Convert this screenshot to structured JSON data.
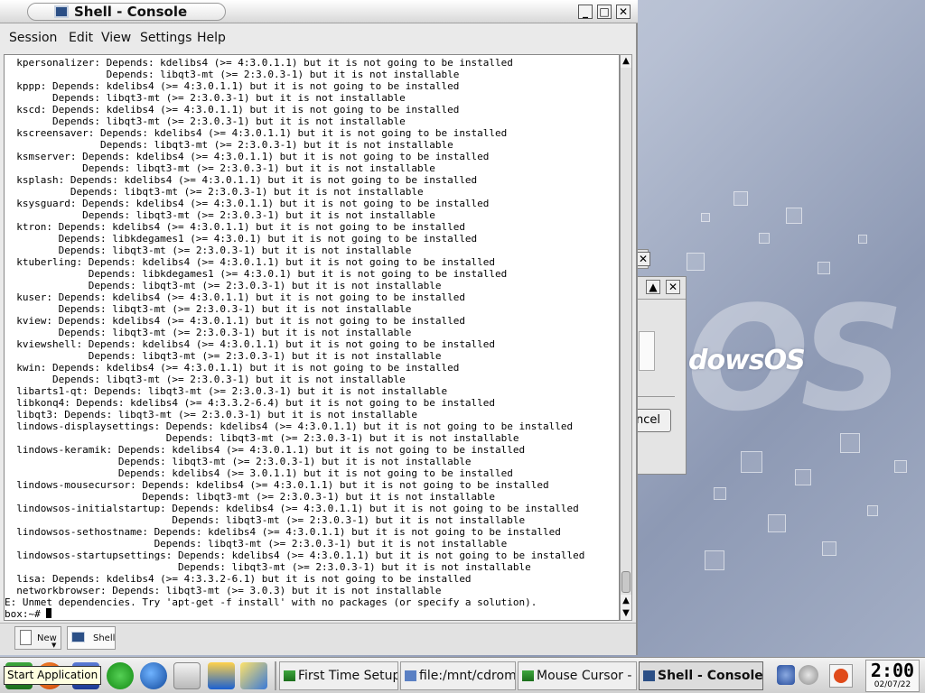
{
  "desktop": {
    "logo_text": "dowsOS",
    "logo_big": "OS",
    "bg_dialog_cancel": "ncel"
  },
  "window": {
    "title": "Shell - Console",
    "controls": {
      "minimize": "_",
      "maximize": "□",
      "close": "✕"
    }
  },
  "menubar": {
    "items": [
      "Session",
      "Edit",
      "View",
      "Settings",
      "Help"
    ]
  },
  "terminal": {
    "lines": [
      "  kpersonalizer: Depends: kdelibs4 (>= 4:3.0.1.1) but it is not going to be installed",
      "                 Depends: libqt3-mt (>= 2:3.0.3-1) but it is not installable",
      "  kppp: Depends: kdelibs4 (>= 4:3.0.1.1) but it is not going to be installed",
      "        Depends: libqt3-mt (>= 2:3.0.3-1) but it is not installable",
      "  kscd: Depends: kdelibs4 (>= 4:3.0.1.1) but it is not going to be installed",
      "        Depends: libqt3-mt (>= 2:3.0.3-1) but it is not installable",
      "  kscreensaver: Depends: kdelibs4 (>= 4:3.0.1.1) but it is not going to be installed",
      "                Depends: libqt3-mt (>= 2:3.0.3-1) but it is not installable",
      "  ksmserver: Depends: kdelibs4 (>= 4:3.0.1.1) but it is not going to be installed",
      "             Depends: libqt3-mt (>= 2:3.0.3-1) but it is not installable",
      "  ksplash: Depends: kdelibs4 (>= 4:3.0.1.1) but it is not going to be installed",
      "           Depends: libqt3-mt (>= 2:3.0.3-1) but it is not installable",
      "  ksysguard: Depends: kdelibs4 (>= 4:3.0.1.1) but it is not going to be installed",
      "             Depends: libqt3-mt (>= 2:3.0.3-1) but it is not installable",
      "  ktron: Depends: kdelibs4 (>= 4:3.0.1.1) but it is not going to be installed",
      "         Depends: libkdegames1 (>= 4:3.0.1) but it is not going to be installed",
      "         Depends: libqt3-mt (>= 2:3.0.3-1) but it is not installable",
      "  ktuberling: Depends: kdelibs4 (>= 4:3.0.1.1) but it is not going to be installed",
      "              Depends: libkdegames1 (>= 4:3.0.1) but it is not going to be installed",
      "              Depends: libqt3-mt (>= 2:3.0.3-1) but it is not installable",
      "  kuser: Depends: kdelibs4 (>= 4:3.0.1.1) but it is not going to be installed",
      "         Depends: libqt3-mt (>= 2:3.0.3-1) but it is not installable",
      "  kview: Depends: kdelibs4 (>= 4:3.0.1.1) but it is not going to be installed",
      "         Depends: libqt3-mt (>= 2:3.0.3-1) but it is not installable",
      "  kviewshell: Depends: kdelibs4 (>= 4:3.0.1.1) but it is not going to be installed",
      "              Depends: libqt3-mt (>= 2:3.0.3-1) but it is not installable",
      "  kwin: Depends: kdelibs4 (>= 4:3.0.1.1) but it is not going to be installed",
      "        Depends: libqt3-mt (>= 2:3.0.3-1) but it is not installable",
      "  libarts1-qt: Depends: libqt3-mt (>= 2:3.0.3-1) but it is not installable",
      "  libkonq4: Depends: kdelibs4 (>= 4:3.3.2-6.4) but it is not going to be installed",
      "  libqt3: Depends: libqt3-mt (>= 2:3.0.3-1) but it is not installable",
      "  lindows-displaysettings: Depends: kdelibs4 (>= 4:3.0.1.1) but it is not going to be installed",
      "                           Depends: libqt3-mt (>= 2:3.0.3-1) but it is not installable",
      "  lindows-keramik: Depends: kdelibs4 (>= 4:3.0.1.1) but it is not going to be installed",
      "                   Depends: libqt3-mt (>= 2:3.0.3-1) but it is not installable",
      "                   Depends: kdelibs4 (>= 3.0.1.1) but it is not going to be installed",
      "  lindows-mousecursor: Depends: kdelibs4 (>= 4:3.0.1.1) but it is not going to be installed",
      "                       Depends: libqt3-mt (>= 2:3.0.3-1) but it is not installable",
      "  lindowsos-initialstartup: Depends: kdelibs4 (>= 4:3.0.1.1) but it is not going to be installed",
      "                            Depends: libqt3-mt (>= 2:3.0.3-1) but it is not installable",
      "  lindowsos-sethostname: Depends: kdelibs4 (>= 4:3.0.1.1) but it is not going to be installed",
      "                         Depends: libqt3-mt (>= 2:3.0.3-1) but it is not installable",
      "  lindowsos-startupsettings: Depends: kdelibs4 (>= 4:3.0.1.1) but it is not going to be installed",
      "                             Depends: libqt3-mt (>= 2:3.0.3-1) but it is not installable",
      "  lisa: Depends: kdelibs4 (>= 4:3.3.2-6.1) but it is not going to be installed",
      "  networkbrowser: Depends: libqt3-mt (>= 3.0.3) but it is not installable",
      "E: Unmet dependencies. Try 'apt-get -f install' with no packages (or specify a solution)."
    ],
    "prompt": "box:~# "
  },
  "konsole_tabs": [
    {
      "label": "New"
    },
    {
      "label": "Shell"
    }
  ],
  "panel": {
    "start_tooltip": "Start Application",
    "tasks": [
      {
        "label": "First Time Setup"
      },
      {
        "label": "file:/mnt/cdrom1"
      },
      {
        "label": "Mouse Cursor -"
      },
      {
        "label": "Shell - Console"
      }
    ],
    "clock_time": "2:00",
    "clock_date": "02/07/22"
  },
  "colors": {
    "accent": "#2b4f86",
    "terminal_bg": "#ffffff",
    "terminal_fg": "#000000"
  }
}
